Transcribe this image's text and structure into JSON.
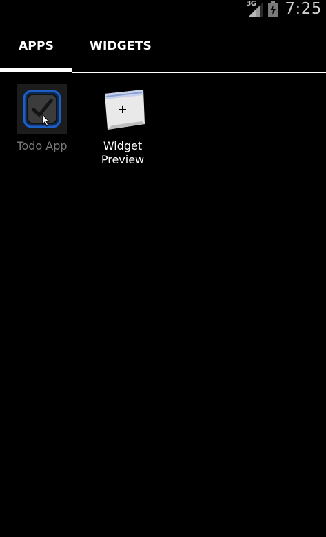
{
  "status_bar": {
    "network_type": "3G",
    "time": "7:25",
    "signal_icon": "signal-bars-icon",
    "battery_icon": "battery-charging-icon"
  },
  "tabs": [
    {
      "label": "APPS",
      "selected": true
    },
    {
      "label": "WIDGETS",
      "selected": false
    }
  ],
  "apps": [
    {
      "label": "Todo App",
      "icon": "checkbox-icon",
      "pressed": true
    },
    {
      "label": "Widget\nPreview",
      "icon": "widget-preview-icon",
      "pressed": false
    }
  ],
  "colors": {
    "background": "#000000",
    "tab_indicator": "#ffffff",
    "todo_icon_ring": "#1e5fc4",
    "dim_label": "#7a7a7a"
  }
}
